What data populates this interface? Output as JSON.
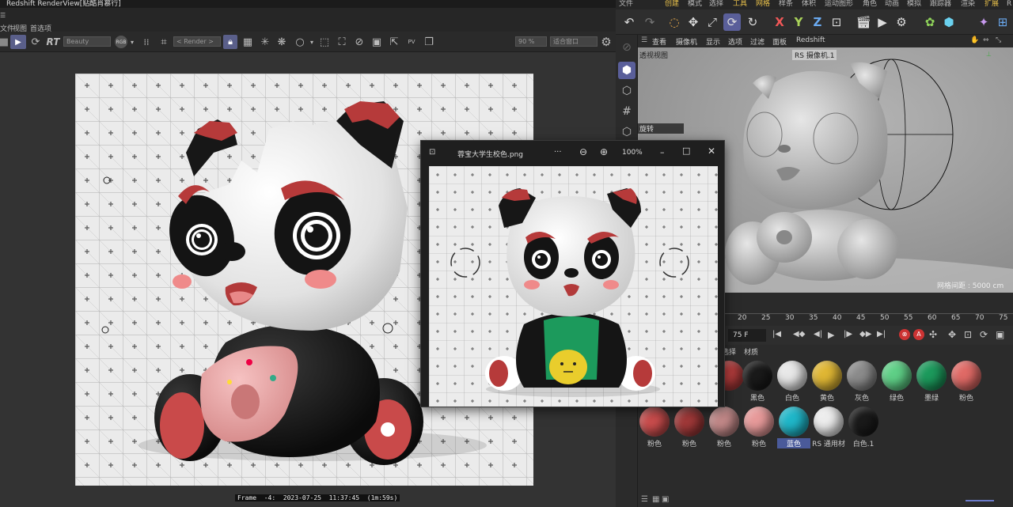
{
  "renderview": {
    "title": "Redshift RenderView[贴酷肖慕行]",
    "menu": [
      "文件",
      "视图",
      "首选项"
    ],
    "rt_label": "RT",
    "aov_select": "Beauty",
    "rgb_badge": "RGB",
    "render_select": "< Render >",
    "zoom": "90 %",
    "fit_select": "适合窗口",
    "frame_info": "Frame  -4:  2023-07-25  11:37:45  (1m:59s)"
  },
  "c4d": {
    "top_menu": [
      "文件",
      "创建",
      "模式",
      "选择",
      "工具",
      "网格",
      "样条",
      "体积",
      "运动图形",
      "角色",
      "动画",
      "模拟",
      "跟踪器",
      "渲染",
      "扩展",
      "R"
    ],
    "active_menu": "网格",
    "axis_x": "X",
    "axis_y": "Y",
    "axis_z": "Z",
    "viewport_menu": [
      "查看",
      "摄像机",
      "显示",
      "选项",
      "过滤",
      "面板",
      "Redshift"
    ],
    "viewport_name": "透视视图",
    "camera_label": "RS 摄像机.1",
    "rotate_label": "旋转",
    "grid_label": "网格间距 : 5000 cm",
    "ruler_ticks": [
      "20",
      "25",
      "30",
      "35",
      "40",
      "45",
      "50",
      "55",
      "60",
      "65",
      "70",
      "75"
    ],
    "frame_field": "75 F",
    "mat_tabs": [
      "选择",
      "材质"
    ],
    "materials": [
      {
        "label": "",
        "color": "#b83e3e"
      },
      {
        "label": "黑色",
        "color": "#1a1a1a"
      },
      {
        "label": "白色",
        "color": "#e8e8e8"
      },
      {
        "label": "黄色",
        "color": "#e0b734"
      },
      {
        "label": "灰色",
        "color": "#8c8c8c"
      },
      {
        "label": "绿色",
        "color": "#5fd087"
      },
      {
        "label": "墨绿",
        "color": "#1c9a5c"
      },
      {
        "label": "粉色",
        "color": "#e06a66"
      },
      {
        "label": "粉色",
        "color": "#cc4e4e"
      },
      {
        "label": "粉色",
        "color": "#a33a3a"
      },
      {
        "label": "粉色",
        "color": "#c48a8a"
      },
      {
        "label": "粉色",
        "color": "#e79a9a"
      },
      {
        "label": "蓝色",
        "color": "#1fb7c9"
      },
      {
        "label": "RS 通用材",
        "color": "#ededed"
      },
      {
        "label": "白色.1",
        "color": "#1a1a1a"
      }
    ],
    "selected_material": "蓝色"
  },
  "photo_viewer": {
    "filename": "蓉宝大学生校色.png",
    "more": "···",
    "zoom": "100%"
  }
}
